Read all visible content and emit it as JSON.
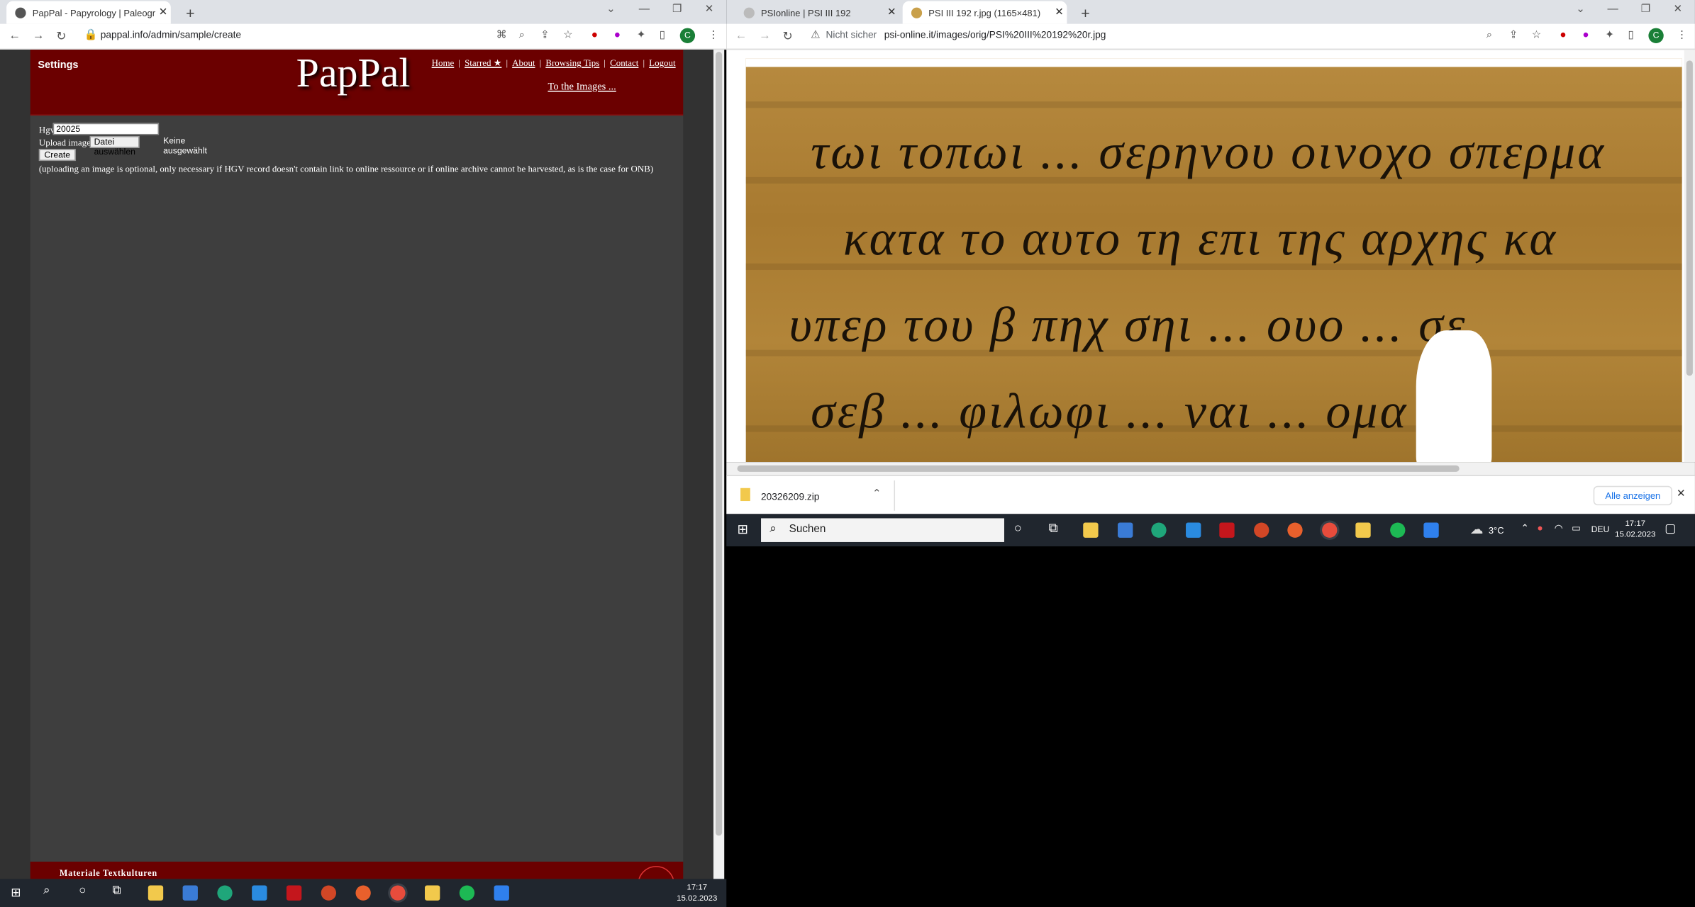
{
  "left_browser": {
    "tab_title": "PapPal - Papyrology | Paleograph",
    "url": "pappal.info/admin/sample/create"
  },
  "pappal": {
    "settings": "Settings",
    "logo": "PapPal",
    "nav": [
      "Home",
      "Starred ★",
      "About",
      "Browsing Tips",
      "Contact",
      "Logout"
    ],
    "to_images": "To the Images ...",
    "hgv_label": "Hgv",
    "hgv_value": "20025",
    "upload_label": "Upload image",
    "file_button": "Datei auswählen",
    "file_status": "Keine ausgewählt",
    "create_button": "Create",
    "note": "(uploading an image is optional, only necessary if HGV record doesn't contain link to online ressource or if online archive cannot be harvested, as is the case for ONB)",
    "footer": "Materiale Textkulturen"
  },
  "right_browser": {
    "tabs": [
      {
        "title": "PSIonline | PSI III 192"
      },
      {
        "title": "PSI III 192 r.jpg (1165×481)"
      }
    ],
    "security": "Nicht sicher",
    "url": "psi-online.it/images/orig/PSI%20III%20192%20r.jpg"
  },
  "download": {
    "file": "20326209.zip",
    "show_all": "Alle anzeigen"
  },
  "taskbar_right": {
    "search": "Suchen",
    "weather": "3°C",
    "lang": "DEU",
    "time": "17:17",
    "date": "15.02.2023"
  },
  "taskbar_left": {
    "time": "17:17",
    "date": "15.02.2023"
  },
  "papyrus_lines": [
    "τωι τοπωι ... σερηνου οινοχο  σπερμα",
    "κατα το αυτο τη επι της αρχης κα",
    "υπερ του β πηχ σηι ... ουο  ... σε",
    "σεβ ... φιλωφι  ... ναι   ... ομα"
  ]
}
